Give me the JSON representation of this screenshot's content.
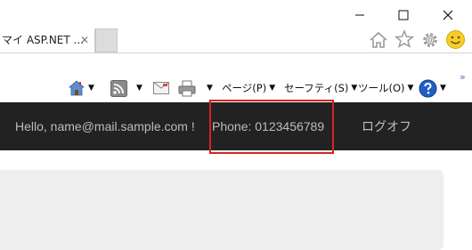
{
  "window": {
    "minimize_icon": "minimize-icon",
    "maximize_icon": "maximize-icon",
    "close_icon": "close-icon"
  },
  "tab": {
    "title": "マイ ASP.NET ...",
    "close_glyph": "✕"
  },
  "toolbar_right": {
    "icons": [
      "home-icon",
      "star-icon",
      "gear-icon",
      "smiley-icon"
    ]
  },
  "command_bar": {
    "page_label": "ページ(P)",
    "safety_label": "セーフティ(S)",
    "tools_label": "ツール(O)",
    "more_glyph": "»",
    "caret_glyph": "▼"
  },
  "navbar": {
    "hello": "Hello, name@mail.sample.com !",
    "phone": "Phone: 0123456789",
    "logoff": "ログオフ"
  },
  "colors": {
    "navbar_bg": "#222222",
    "navbar_text": "#bdbdbd",
    "highlight": "#d62222",
    "panel_bg": "#eeeeee"
  }
}
